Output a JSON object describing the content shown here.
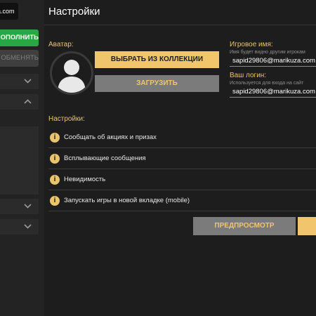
{
  "sidebar": {
    "top_text": "a.com",
    "deposit_label": "ОПОЛНИТЬ",
    "exchange_label": "ОБМЕНЯТЬ"
  },
  "settings": {
    "title": "Настройки",
    "avatar_label": "Аватар:",
    "choose_collection_label": "ВЫБРАТЬ ИЗ КОЛЛЕКЦИИ",
    "upload_label": "ЗАГРУЗИТЬ",
    "game_name": {
      "label": "Игровое имя:",
      "hint": "Имя будет видно другим игрокам",
      "value": "sapid29806@marikuza.com"
    },
    "login": {
      "label": "Ваш логин:",
      "hint": "Используется для входа на сайт",
      "value": "sapid29806@marikuza.com"
    },
    "options_label": "Настройки:",
    "options": [
      {
        "label": "Сообщать об акциях и призах"
      },
      {
        "label": "Всплывающие сообщения"
      },
      {
        "label": "Невидимость"
      },
      {
        "label": "Запускать игры в новой вкладке (mobile)"
      }
    ],
    "info_glyph": "i",
    "preview_label": "ПРЕДПРОСМОТР"
  },
  "colors": {
    "accent": "#f0c56b",
    "green": "#27a844",
    "background": "#1d1d1d"
  }
}
